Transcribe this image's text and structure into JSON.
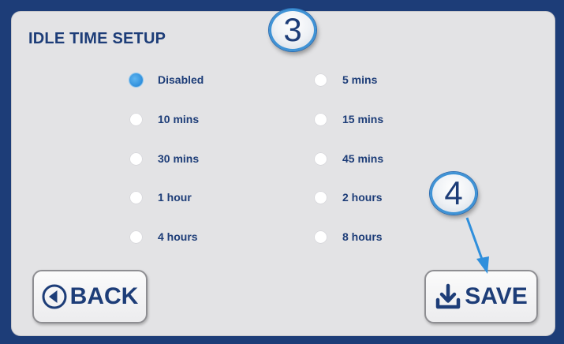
{
  "title": "IDLE TIME SETUP",
  "options_left": [
    {
      "label": "Disabled",
      "checked": true
    },
    {
      "label": "10 mins",
      "checked": false
    },
    {
      "label": "30 mins",
      "checked": false
    },
    {
      "label": "1 hour",
      "checked": false
    },
    {
      "label": "4 hours",
      "checked": false
    }
  ],
  "options_right": [
    {
      "label": "5 mins",
      "checked": false
    },
    {
      "label": "15 mins",
      "checked": false
    },
    {
      "label": "45 mins",
      "checked": false
    },
    {
      "label": "2 hours",
      "checked": false
    },
    {
      "label": "8 hours",
      "checked": false
    }
  ],
  "buttons": {
    "back_label": "BACK",
    "back_icon": "back-circle-arrow-icon",
    "save_label": "SAVE",
    "save_icon": "download-tray-icon"
  },
  "annotations": {
    "step_3": "3",
    "step_4": "4"
  },
  "colors": {
    "frame": "#1d3d78",
    "panel": "#e3e3e5",
    "text": "#1d3d78",
    "radio_selected": "#2f8fdc",
    "annotation_ring": "#3f93d6"
  }
}
